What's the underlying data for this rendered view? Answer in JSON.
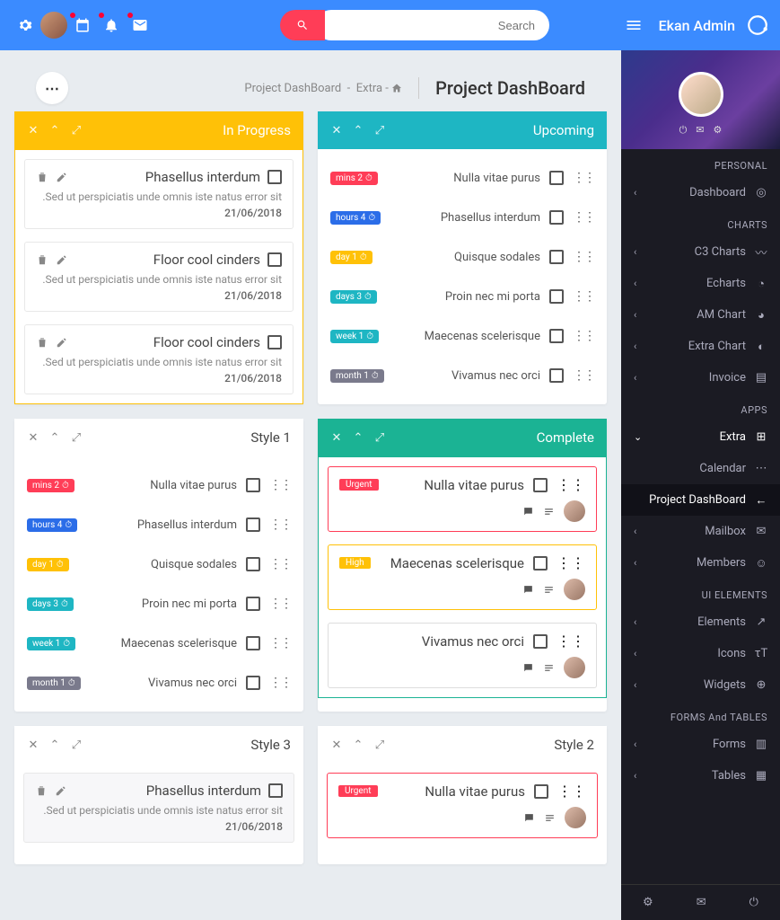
{
  "topnav": {
    "search_placeholder": "Search",
    "brand": "Ekan Admin"
  },
  "breadcrumb": {
    "page": "Project DashBoard",
    "extra": "Extra",
    "title": "Project DashBoard"
  },
  "cards": {
    "in_progress": {
      "title": "In Progress",
      "items": [
        {
          "title": "Phasellus interdum",
          "sub": ".Sed ut perspiciatis unde omnis iste natus error sit",
          "date": "21/06/2018"
        },
        {
          "title": "Floor cool cinders",
          "sub": ".Sed ut perspiciatis unde omnis iste natus error sit",
          "date": "21/06/2018"
        },
        {
          "title": "Floor cool cinders",
          "sub": ".Sed ut perspiciatis unde omnis iste natus error sit",
          "date": "21/06/2018"
        }
      ]
    },
    "upcoming": {
      "title": "Upcoming",
      "items": [
        {
          "badge": "mins 2",
          "badge_color": "red",
          "label": "Nulla vitae purus"
        },
        {
          "badge": "hours 4",
          "badge_color": "blue",
          "label": "Phasellus interdum"
        },
        {
          "badge": "day 1",
          "badge_color": "yellow",
          "label": "Quisque sodales"
        },
        {
          "badge": "days 3",
          "badge_color": "teal",
          "label": "Proin nec mi porta"
        },
        {
          "badge": "week 1",
          "badge_color": "teal",
          "label": "Maecenas scelerisque"
        },
        {
          "badge": "month 1",
          "badge_color": "grey",
          "label": "Vivamus nec orci"
        }
      ]
    },
    "style1": {
      "title": "Style 1"
    },
    "complete": {
      "title": "Complete",
      "items": [
        {
          "pill": "Urgent",
          "pill_color": "red",
          "title": "Nulla vitae purus",
          "border": "red"
        },
        {
          "pill": "High",
          "pill_color": "yellow",
          "title": "Maecenas scelerisque",
          "border": "yellow"
        },
        {
          "pill": "",
          "pill_color": "",
          "title": "Vivamus nec orci",
          "border": "grey"
        }
      ]
    },
    "style3": {
      "title": "Style 3",
      "items": [
        {
          "title": "Phasellus interdum",
          "sub": ".Sed ut perspiciatis unde omnis iste natus error sit",
          "date": "21/06/2018"
        }
      ]
    },
    "style2": {
      "title": "Style 2",
      "items": [
        {
          "pill": "Urgent",
          "pill_color": "red",
          "title": "Nulla vitae purus",
          "border": "red"
        }
      ]
    }
  },
  "sidebar": {
    "sections": {
      "personal": "PERSONAL",
      "charts": "CHARTS",
      "apps": "APPS",
      "ui": "UI ELEMENTS",
      "forms": "FORMS And TABLES"
    },
    "items": {
      "dashboard": "Dashboard",
      "c3": "C3 Charts",
      "echarts": "Echarts",
      "am": "AM Chart",
      "extra_chart": "Extra Chart",
      "invoice": "Invoice",
      "extra": "Extra",
      "calendar": "Calendar",
      "project": "Project DashBoard",
      "mailbox": "Mailbox",
      "members": "Members",
      "elements": "Elements",
      "icons": "Icons",
      "widgets": "Widgets",
      "forms": "Forms",
      "tables": "Tables"
    }
  }
}
